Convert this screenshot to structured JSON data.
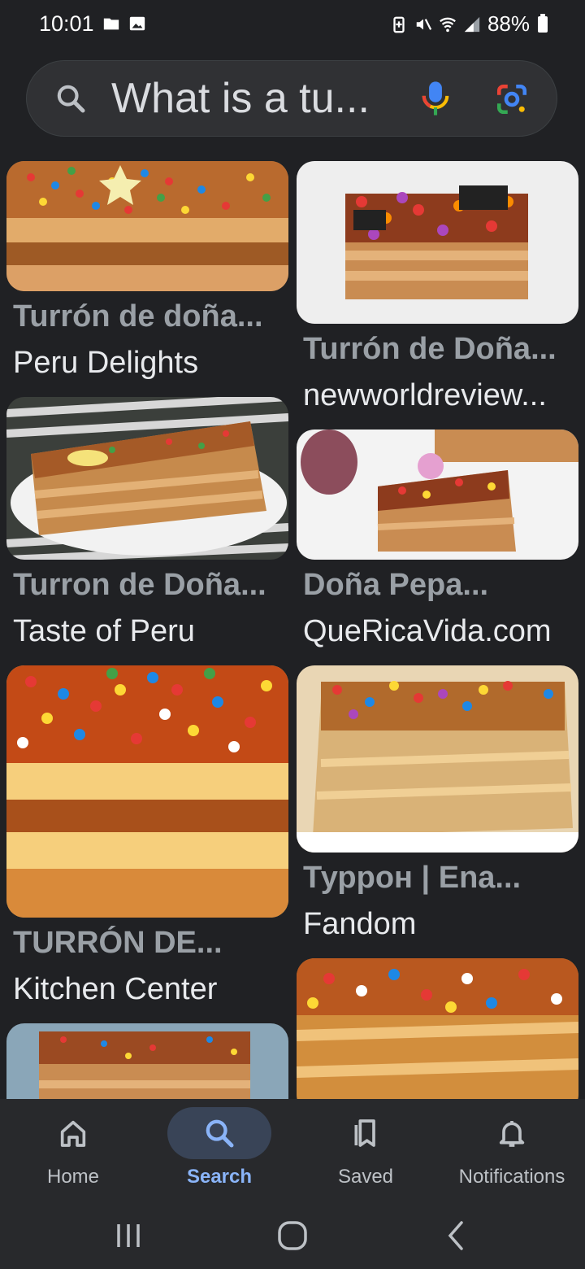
{
  "status_bar": {
    "time": "10:01",
    "battery": "88%"
  },
  "search": {
    "query": "What is a tu..."
  },
  "results": [
    {
      "title": "Turrón de doña...",
      "source": "Peru Delights"
    },
    {
      "title": "Turrón de Doña...",
      "source": "newworldreview..."
    },
    {
      "title": "Turron de Doña...",
      "source": "Taste of Peru"
    },
    {
      "title": "Doña Pepa...",
      "source": "QueRicaVida.com"
    },
    {
      "title": "TURRÓN DE...",
      "source": "Kitchen Center"
    },
    {
      "title": "Туррон | Ena...",
      "source": "Fandom"
    }
  ],
  "bottom_nav": {
    "items": [
      {
        "label": "Home",
        "icon": "home-icon"
      },
      {
        "label": "Search",
        "icon": "search-icon"
      },
      {
        "label": "Saved",
        "icon": "bookmarks-icon"
      },
      {
        "label": "Notifications",
        "icon": "bell-icon"
      }
    ],
    "active": "Search"
  },
  "colors": {
    "background": "#202124",
    "accent": "#8ab4f8",
    "search_pill": "#394457"
  }
}
